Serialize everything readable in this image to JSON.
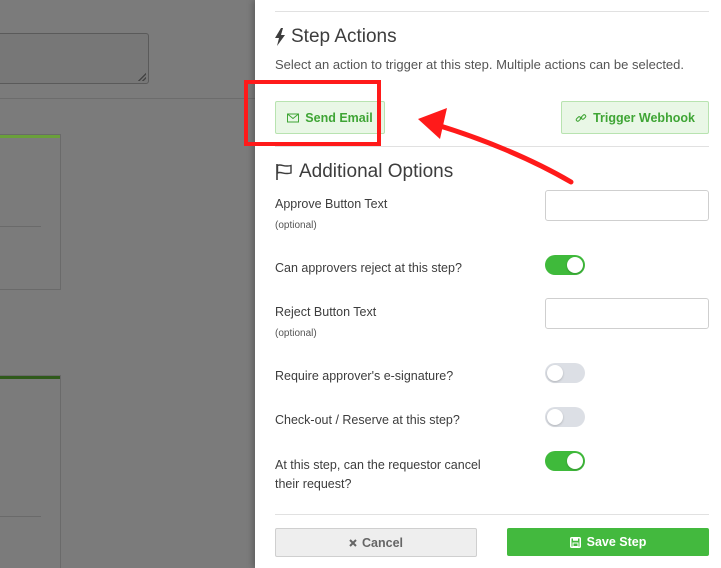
{
  "panel": {
    "step_actions": {
      "title": "Step Actions",
      "icon": "bolt-icon",
      "subtitle": "Select an action to trigger at this step. Multiple actions can be selected.",
      "send_email_label": "Send Email",
      "trigger_webhook_label": "Trigger Webhook"
    },
    "additional_options": {
      "title": "Additional Options",
      "icon": "flag-icon",
      "approve_button_text": {
        "label": "Approve Button Text",
        "hint": "(optional)",
        "value": ""
      },
      "can_reject": {
        "label": "Can approvers reject at this step?",
        "enabled": true
      },
      "reject_button_text": {
        "label": "Reject Button Text",
        "hint": "(optional)",
        "value": ""
      },
      "require_esignature": {
        "label": "Require approver's e-signature?",
        "enabled": false
      },
      "checkout_reserve": {
        "label": "Check-out / Reserve at this step?",
        "enabled": false
      },
      "requestor_cancel": {
        "label_line1": "At this step, can the requestor cancel",
        "label_line2": "their request?",
        "enabled": true
      }
    },
    "footer": {
      "cancel_label": "Cancel",
      "save_label": "Save Step"
    }
  },
  "colors": {
    "accent_green": "#43b93e",
    "annotation_red": "#ff1a1a"
  }
}
